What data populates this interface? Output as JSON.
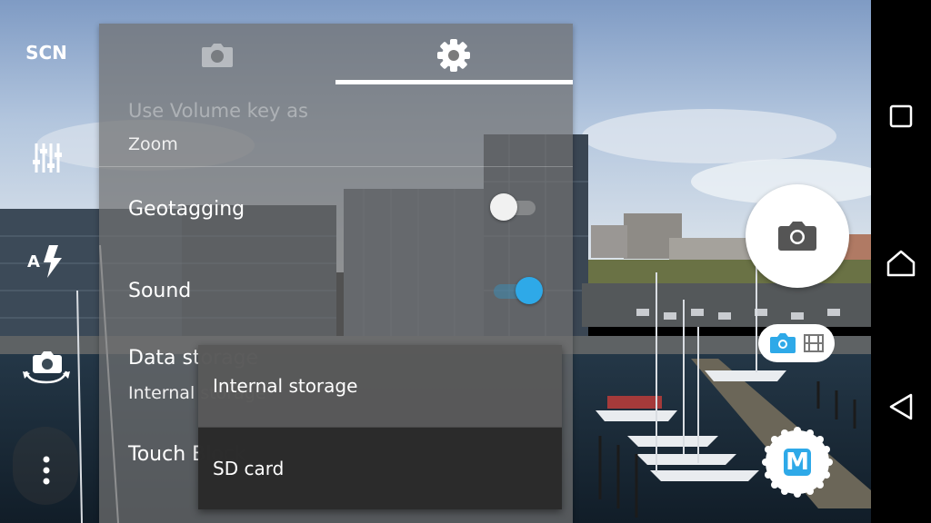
{
  "left_rail": {
    "scene_label": "SCN",
    "icons": [
      "sliders-icon",
      "auto-flash-icon",
      "switch-camera-icon",
      "more-vert-icon"
    ]
  },
  "settings_panel": {
    "tabs": [
      {
        "name": "camera-tab",
        "icon": "camera-icon",
        "selected": false
      },
      {
        "name": "settings-tab",
        "icon": "gear-icon",
        "selected": true
      }
    ],
    "rows": {
      "volume_key": {
        "title": "Use Volume key as",
        "value": "Zoom"
      },
      "geotagging": {
        "title": "Geotagging",
        "enabled": false
      },
      "sound": {
        "title": "Sound",
        "enabled": true
      },
      "data_storage": {
        "title": "Data storage",
        "value": "Internal storage"
      },
      "touch_block": {
        "title": "Touch Block"
      }
    }
  },
  "storage_popup": {
    "options": [
      "Internal storage",
      "SD card"
    ],
    "selected": "Internal storage"
  },
  "right_controls": {
    "shutter_icon": "camera-icon",
    "mode_toggle": {
      "photo_icon": "camera-icon",
      "video_icon": "film-icon",
      "active": "photo"
    },
    "manual_label": "M"
  },
  "nav_bar": {
    "buttons": [
      "recents-icon",
      "home-icon",
      "back-icon"
    ]
  },
  "colors": {
    "accent": "#2ea9e8",
    "panel": "#707070"
  }
}
